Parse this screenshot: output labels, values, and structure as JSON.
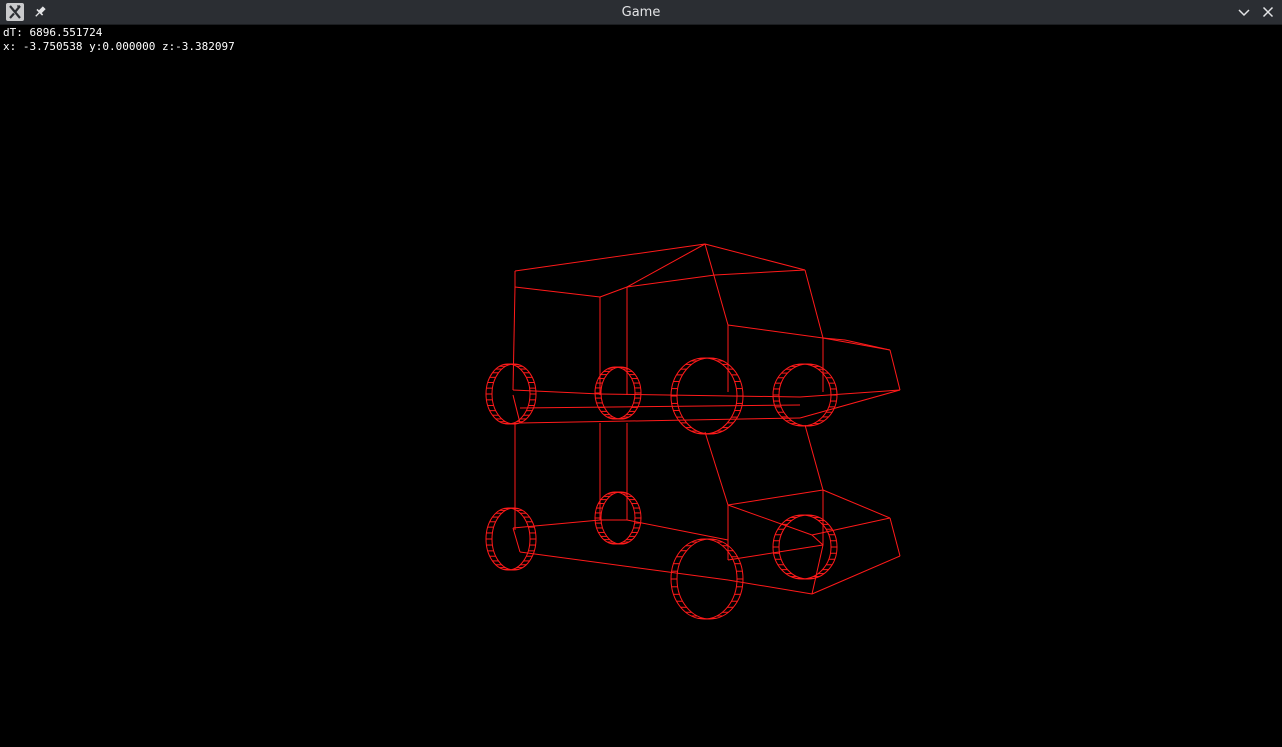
{
  "window": {
    "title": "Game",
    "app_icon": "x-window-icon",
    "pin_icon": "pin-icon",
    "minimize_icon": "chevron-down-icon",
    "close_icon": "close-icon"
  },
  "hud": {
    "dt_text": "dT: 6896.551724",
    "position_text": "x: -3.750538 y:0.000000 z:-3.382097"
  },
  "scene": {
    "description_colors": {
      "background": "#000000",
      "wireframe": "#ff1a1a"
    }
  }
}
